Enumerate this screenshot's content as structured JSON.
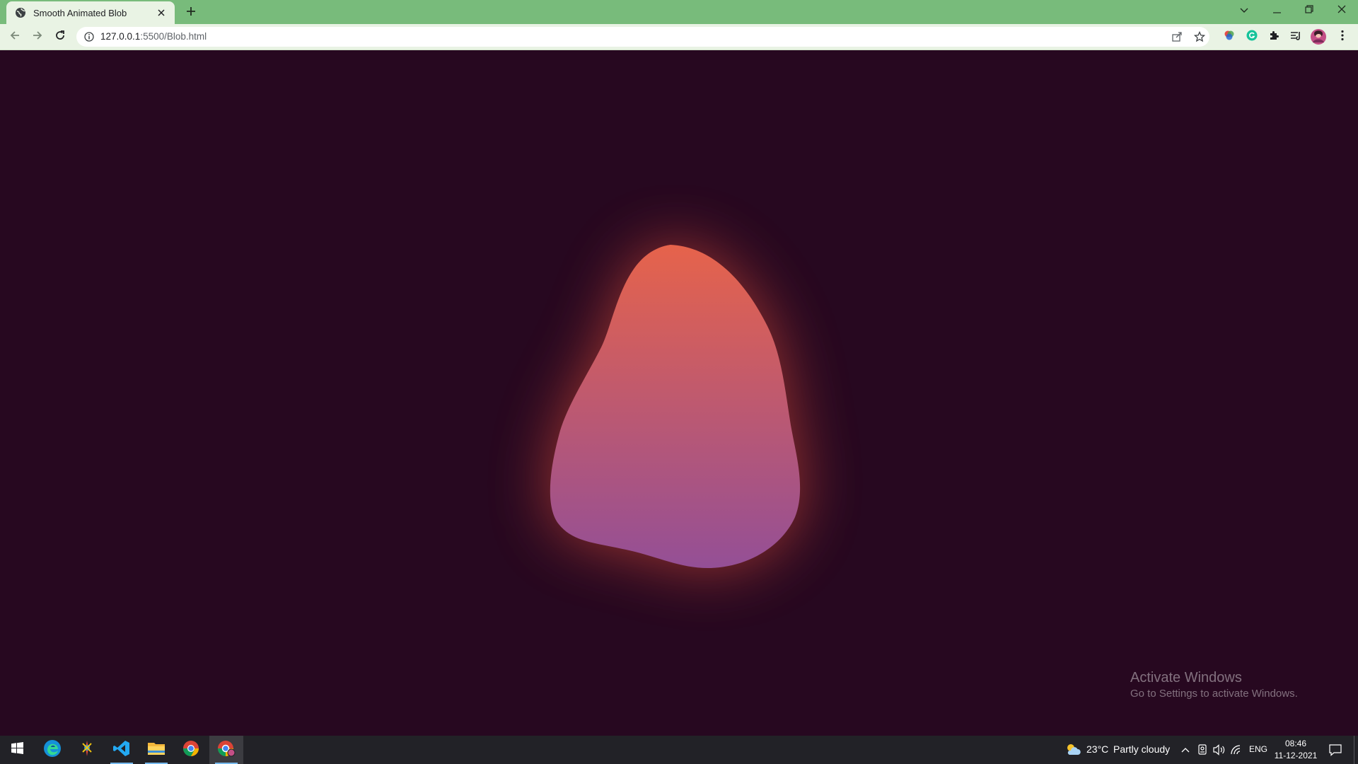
{
  "browser": {
    "tab": {
      "title": "Smooth Animated Blob",
      "favicon": "globe-icon"
    },
    "new_tab_icon": "plus-icon",
    "window_controls": [
      "tab-search-icon",
      "minimize-icon",
      "restore-icon",
      "close-icon"
    ],
    "address": {
      "host": "127.0.0.1",
      "rest": ":5500/Blob.html",
      "info_icon": "info-icon"
    },
    "nav_icons": [
      "back-arrow-icon",
      "forward-arrow-icon",
      "reload-icon"
    ],
    "omnibox_actions": [
      "share-icon",
      "bookmark-star-icon"
    ],
    "extensions": [
      "color-wheel-icon",
      "grammarly-icon",
      "puzzle-extensions-icon",
      "reading-list-icon",
      "profile-avatar",
      "kebab-menu-icon"
    ]
  },
  "page": {
    "background": "#270820",
    "blob": {
      "gradient_top": "#e6634b",
      "gradient_bottom": "#944f96",
      "glow": "#ff5a3c"
    },
    "watermark": {
      "title": "Activate Windows",
      "subtitle": "Go to Settings to activate Windows."
    }
  },
  "taskbar": {
    "apps": [
      "windows-start-icon",
      "edge-icon",
      "paint-app-icon",
      "vscode-icon",
      "file-explorer-icon",
      "chrome-icon",
      "chrome-profile-icon"
    ],
    "weather": {
      "temp": "23°C",
      "condition": "Partly cloudy",
      "icon": "partly-cloudy-icon"
    },
    "tray_icons": [
      "chevron-up-icon",
      "meet-now-icon",
      "volume-icon",
      "wifi-icon"
    ],
    "language": "ENG",
    "time": "08:46",
    "date": "11-12-2021",
    "notification_icon": "notification-icon"
  }
}
